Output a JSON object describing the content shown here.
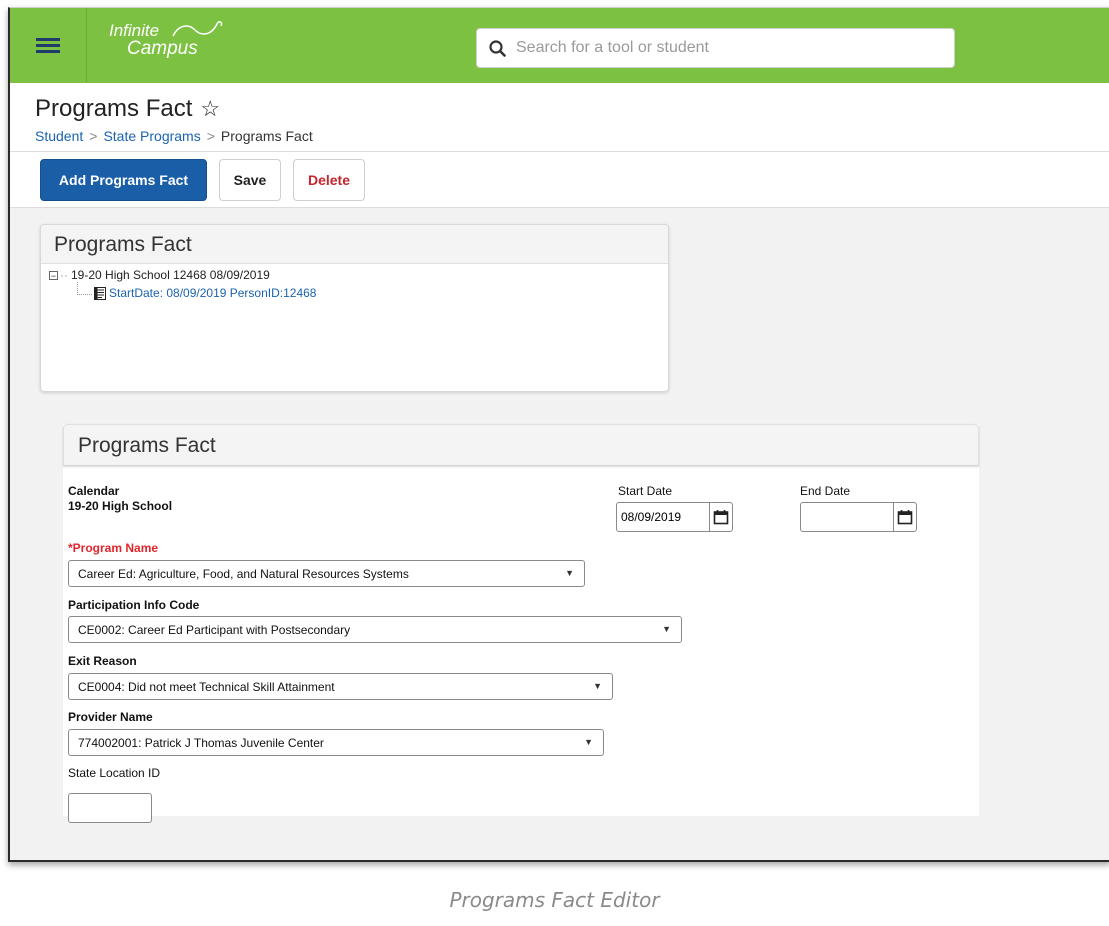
{
  "app": {
    "logo_line1": "Infinite",
    "logo_line2": "Campus",
    "search_placeholder": "Search for a tool or student"
  },
  "page": {
    "title": "Programs Fact",
    "breadcrumb": [
      "Student",
      "State Programs",
      "Programs Fact"
    ]
  },
  "toolbar": {
    "add_label": "Add Programs Fact",
    "save_label": "Save",
    "delete_label": "Delete"
  },
  "tree_panel": {
    "title": "Programs Fact",
    "root": "19-20 High School 12468 08/09/2019",
    "child": "StartDate: 08/09/2019 PersonID:12468"
  },
  "editor": {
    "title": "Programs Fact",
    "calendar_label": "Calendar",
    "calendar_value": "19-20 High School",
    "start_date_label": "Start Date",
    "start_date_value": "08/09/2019",
    "end_date_label": "End Date",
    "end_date_value": "",
    "program_name_label": "*Program Name",
    "program_name_value": "Career Ed: Agriculture, Food, and Natural Resources Systems",
    "participation_label": "Participation Info Code",
    "participation_value": "CE0002: Career Ed Participant with Postsecondary",
    "exit_reason_label": "Exit Reason",
    "exit_reason_value": "CE0004: Did not meet Technical Skill Attainment",
    "provider_label": "Provider Name",
    "provider_value": "774002001: Patrick J Thomas Juvenile Center",
    "state_location_label": "State Location ID",
    "state_location_value": ""
  },
  "caption": "Programs Fact Editor",
  "colors": {
    "topbar": "#7dc142",
    "primary_button": "#1a5ea8",
    "link": "#1a63b0",
    "required": "#e0262c",
    "delete": "#c4262e"
  }
}
